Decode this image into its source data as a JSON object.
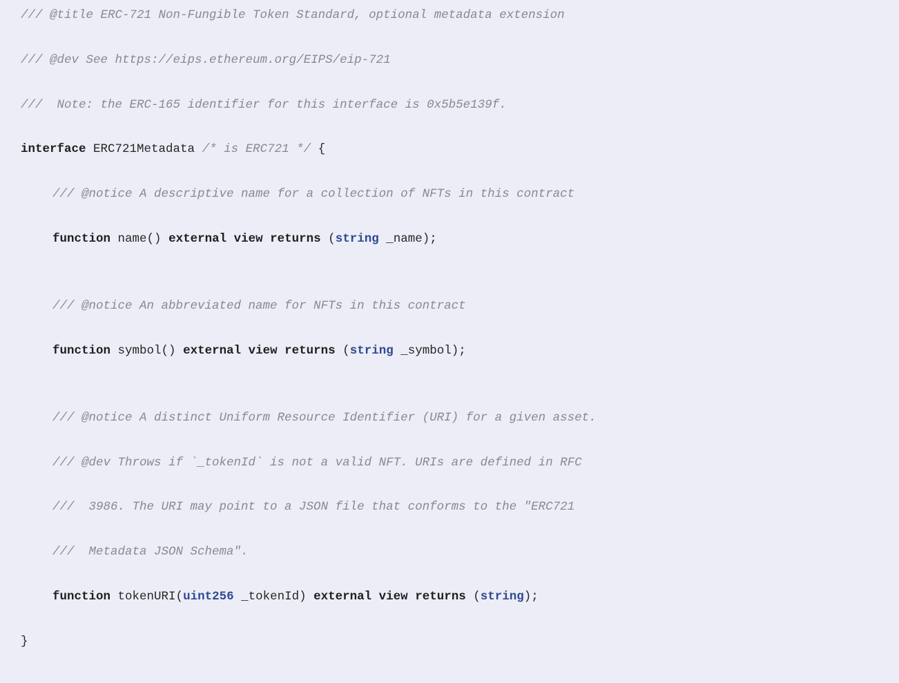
{
  "code": {
    "c_title": "/// @title ERC-721 Non-Fungible Token Standard, optional metadata extension",
    "c_dev": "/// @dev See https://eips.ethereum.org/EIPS/eip-721",
    "c_note": "///  Note: the ERC-165 identifier for this interface is 0x5b5e139f.",
    "kw_interface": "interface",
    "if_name": "ERC721Metadata",
    "c_is": "/* is ERC721 */",
    "brace_open": "{",
    "brace_close": "}",
    "c_name": "/// @notice A descriptive name for a collection of NFTs in this contract",
    "kw_function": "function",
    "fn_name": "name",
    "paren_empty": "()",
    "kw_external": "external",
    "kw_view": "view",
    "kw_returns": "returns",
    "paren_open": "(",
    "paren_close_semi": ");",
    "t_string": "string",
    "p_name": "_name",
    "c_symbol": "/// @notice An abbreviated name for NFTs in this contract",
    "fn_symbol": "symbol",
    "p_symbol": "_symbol",
    "c_uri1": "/// @notice A distinct Uniform Resource Identifier (URI) for a given asset.",
    "c_uri2": "/// @dev Throws if `_tokenId` is not a valid NFT. URIs are defined in RFC",
    "c_uri3": "///  3986. The URI may point to a JSON file that conforms to the \"ERC721",
    "c_uri4": "///  Metadata JSON Schema\".",
    "fn_tokenURI": "tokenURI",
    "t_uint256": "uint256",
    "p_tokenId": "_tokenId",
    "paren_close": ")"
  }
}
